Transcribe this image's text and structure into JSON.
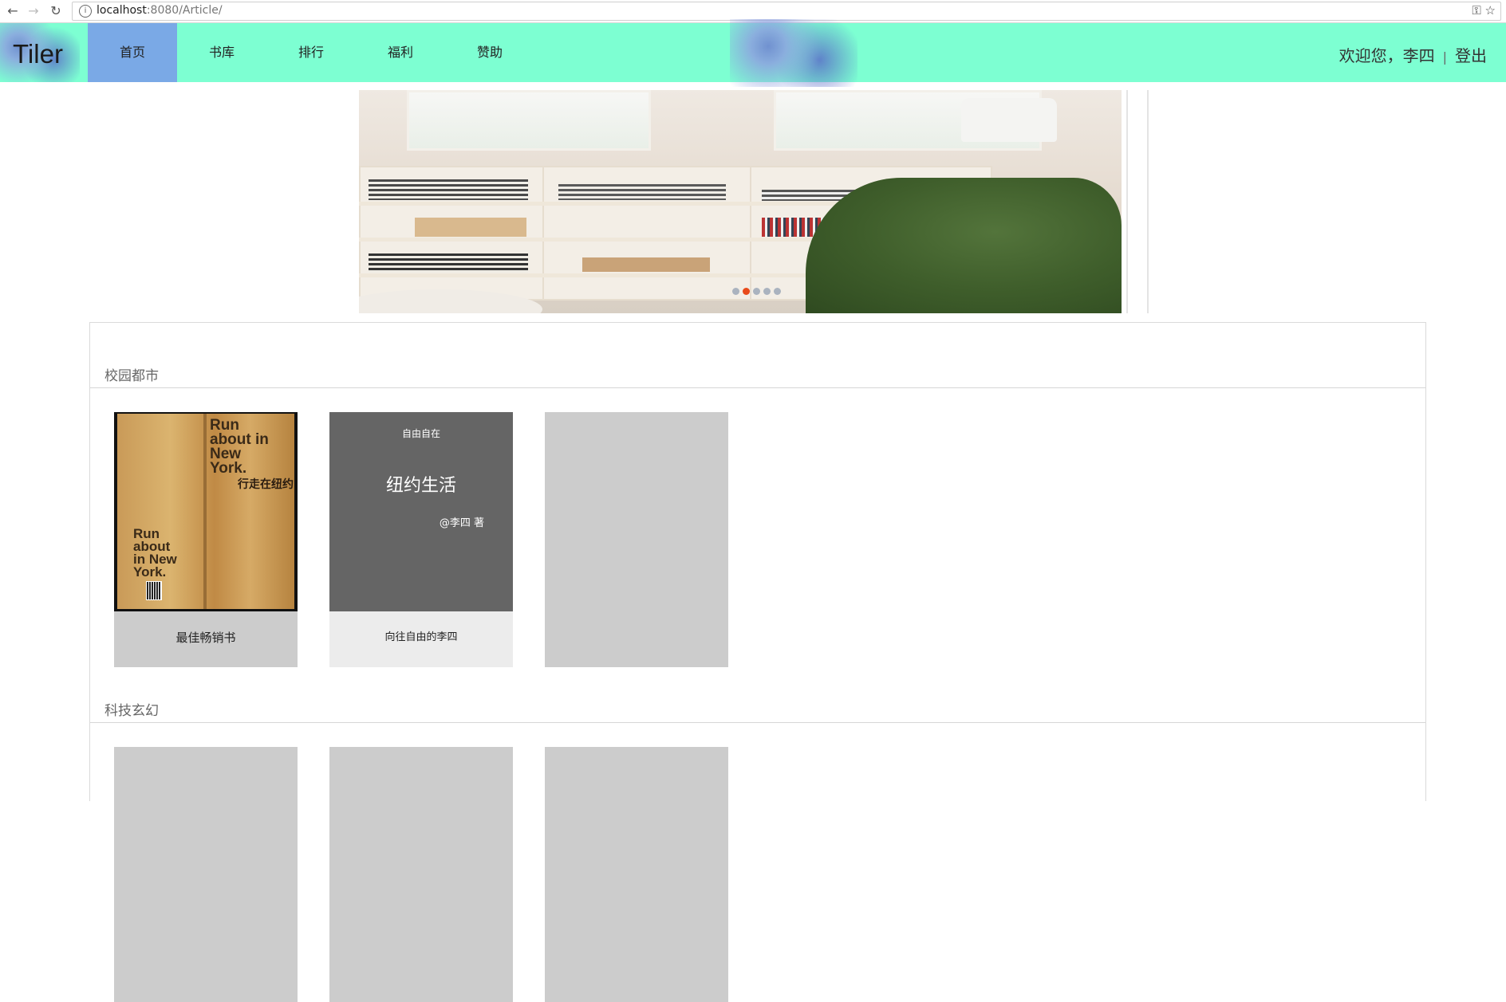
{
  "browser": {
    "url_host": "localhost",
    "url_path": ":8080/Article/",
    "back_icon": "←",
    "forward_icon": "→",
    "reload_icon": "↻",
    "info_icon": "i",
    "key_icon": "⚿",
    "star_icon": "☆"
  },
  "header": {
    "logo": "Tiler",
    "nav": [
      "首页",
      "书库",
      "排行",
      "福利",
      "赞助"
    ],
    "active_index": 0,
    "welcome": "欢迎您，李四",
    "separator": "|",
    "logout": "登出"
  },
  "carousel": {
    "slide_count": 5,
    "active_slide": 2
  },
  "sections": [
    {
      "title": "校园都市",
      "books": [
        {
          "cover_text_top": "Run about in New York.",
          "cover_text_cn": "行走在纽约",
          "cover_text_bottom": "Run about in New York.",
          "caption": "最佳畅销书"
        },
        {
          "cover_top": "自由自在",
          "cover_title": "纽约生活",
          "cover_author": "@李四 著",
          "caption": "向往自由的李四"
        },
        {}
      ]
    },
    {
      "title": "科技玄幻",
      "books": [
        {},
        {},
        {}
      ]
    }
  ],
  "colors": {
    "header_bg": "#7dffd2",
    "nav_active": "#7aa9e6",
    "placeholder": "#cccccc",
    "dot_active": "#e84a1a"
  }
}
